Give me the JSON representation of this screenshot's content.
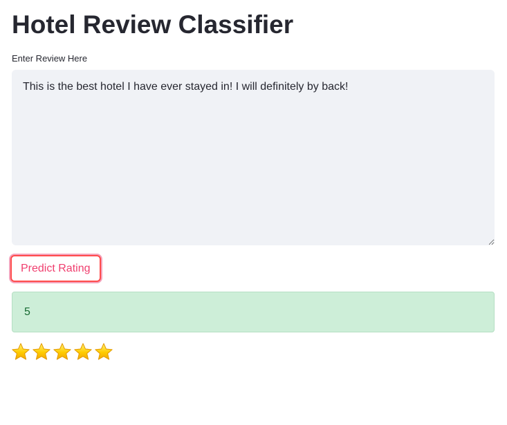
{
  "app": {
    "title": "Hotel Review Classifier"
  },
  "review": {
    "label": "Enter Review Here",
    "value": "This is the best hotel I have ever stayed in! I will definitely by back!"
  },
  "predict_button": {
    "label": "Predict Rating"
  },
  "result": {
    "rating": "5"
  },
  "stars": {
    "count": 5,
    "icon": "star-icon",
    "color": "#ffcc00"
  }
}
